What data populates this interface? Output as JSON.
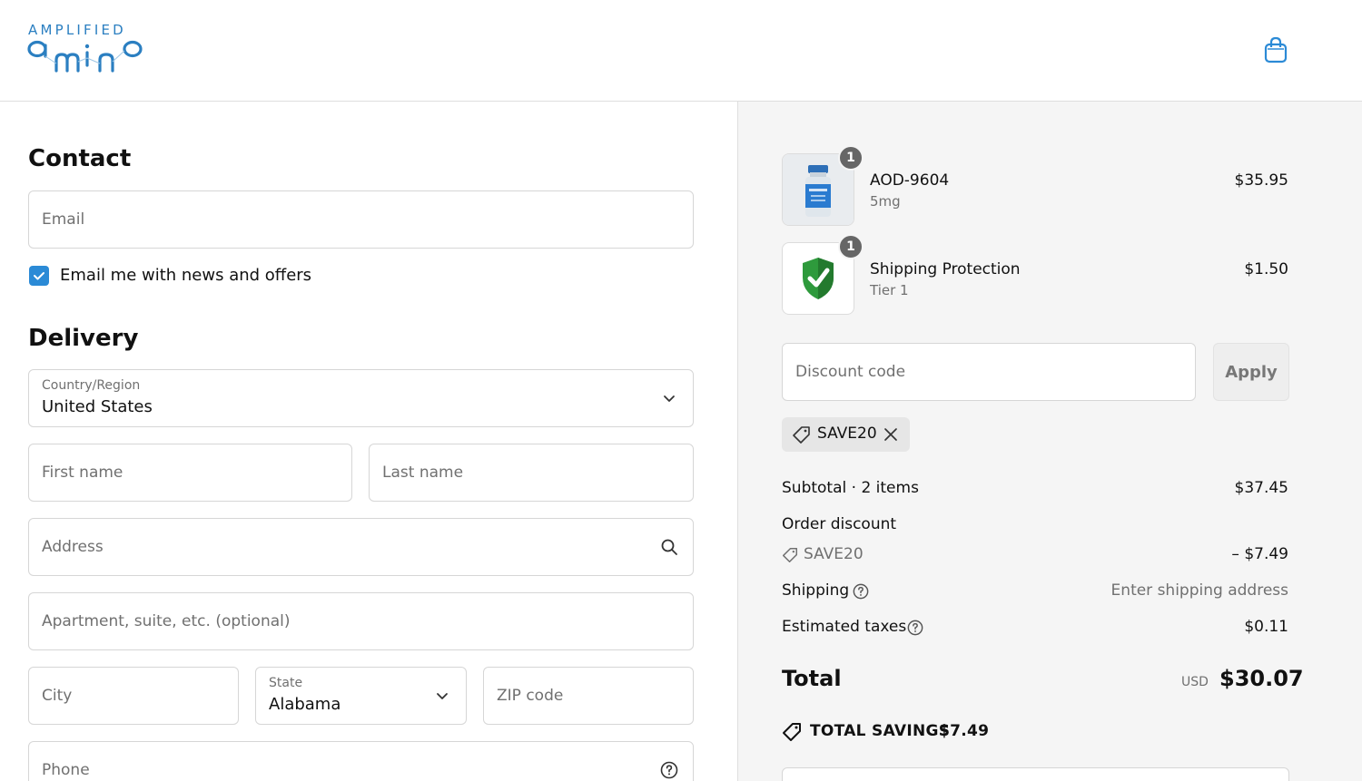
{
  "brand": {
    "logo_top": "AMPLIFIED",
    "logo_bottom": "amino",
    "color": "#2b7fc1"
  },
  "header": {
    "cart_icon": "shopping-bag-icon"
  },
  "contact": {
    "title": "Contact",
    "email_placeholder": "Email",
    "newsletter_label": "Email me with news and offers",
    "newsletter_checked": true
  },
  "delivery": {
    "title": "Delivery",
    "country_label": "Country/Region",
    "country_value": "United States",
    "first_name_placeholder": "First name",
    "last_name_placeholder": "Last name",
    "address_placeholder": "Address",
    "apartment_placeholder": "Apartment, suite, etc. (optional)",
    "city_placeholder": "City",
    "state_label": "State",
    "state_value": "Alabama",
    "zip_placeholder": "ZIP code",
    "phone_placeholder": "Phone"
  },
  "order": {
    "items": [
      {
        "name": "AOD-9604",
        "variant": "5mg",
        "price": "$35.95",
        "quantity": "1",
        "image": "vial-image"
      },
      {
        "name": "Shipping Protection",
        "variant": "Tier 1",
        "price": "$1.50",
        "quantity": "1",
        "image": "shield-check-icon"
      }
    ],
    "discount_placeholder": "Discount code",
    "apply_label": "Apply",
    "applied_code": "SAVE20",
    "subtotal_label": "Subtotal · 2 items",
    "subtotal_value": "$37.45",
    "order_discount_label": "Order discount",
    "discount_code": "SAVE20",
    "discount_value": "– $7.49",
    "shipping_label": "Shipping",
    "shipping_value": "Enter shipping address",
    "taxes_label": "Estimated taxes",
    "taxes_value": "$0.11",
    "total_label": "Total",
    "total_currency": "USD",
    "total_value": "$30.07",
    "savings_label": "TOTAL SAVINGS",
    "savings_value": "$7.49"
  },
  "colors": {
    "accent": "#2b8ad6",
    "shield_green": "#2e9a3c",
    "panel_bg": "#f5f5f5"
  }
}
